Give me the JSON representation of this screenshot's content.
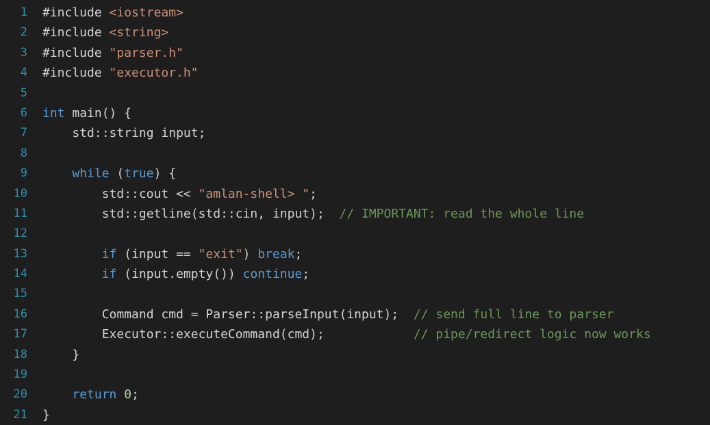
{
  "editor": {
    "colors": {
      "background": "#1e1e1e",
      "line_number": "#2b91af",
      "plain": "#d4d4d4",
      "string": "#ce9178",
      "keyword": "#569cd6",
      "number": "#b5cea8",
      "comment": "#6a9955"
    },
    "lines": [
      {
        "number": "1",
        "tokens": [
          {
            "t": "#include ",
            "k": "directive"
          },
          {
            "t": "<iostream>",
            "k": "string"
          }
        ]
      },
      {
        "number": "2",
        "tokens": [
          {
            "t": "#include ",
            "k": "directive"
          },
          {
            "t": "<string>",
            "k": "string"
          }
        ]
      },
      {
        "number": "3",
        "tokens": [
          {
            "t": "#include ",
            "k": "directive"
          },
          {
            "t": "\"parser.h\"",
            "k": "string"
          }
        ]
      },
      {
        "number": "4",
        "tokens": [
          {
            "t": "#include ",
            "k": "directive"
          },
          {
            "t": "\"executor.h\"",
            "k": "string"
          }
        ]
      },
      {
        "number": "5",
        "tokens": []
      },
      {
        "number": "6",
        "tokens": [
          {
            "t": "int",
            "k": "keyword"
          },
          {
            "t": " main() {",
            "k": "plain"
          }
        ]
      },
      {
        "number": "7",
        "tokens": [
          {
            "t": "    std::string input;",
            "k": "plain"
          }
        ]
      },
      {
        "number": "8",
        "tokens": []
      },
      {
        "number": "9",
        "tokens": [
          {
            "t": "    ",
            "k": "plain"
          },
          {
            "t": "while",
            "k": "control"
          },
          {
            "t": " (",
            "k": "plain"
          },
          {
            "t": "true",
            "k": "keyword"
          },
          {
            "t": ") {",
            "k": "plain"
          }
        ]
      },
      {
        "number": "10",
        "tokens": [
          {
            "t": "        std::cout << ",
            "k": "plain"
          },
          {
            "t": "\"amlan-shell> \"",
            "k": "string"
          },
          {
            "t": ";",
            "k": "plain"
          }
        ]
      },
      {
        "number": "11",
        "tokens": [
          {
            "t": "        std::getline(std::cin, input);  ",
            "k": "plain"
          },
          {
            "t": "// IMPORTANT: read the whole line",
            "k": "comment"
          }
        ]
      },
      {
        "number": "12",
        "tokens": []
      },
      {
        "number": "13",
        "tokens": [
          {
            "t": "        ",
            "k": "plain"
          },
          {
            "t": "if",
            "k": "control"
          },
          {
            "t": " (input == ",
            "k": "plain"
          },
          {
            "t": "\"exit\"",
            "k": "string"
          },
          {
            "t": ") ",
            "k": "plain"
          },
          {
            "t": "break",
            "k": "control"
          },
          {
            "t": ";",
            "k": "plain"
          }
        ]
      },
      {
        "number": "14",
        "tokens": [
          {
            "t": "        ",
            "k": "plain"
          },
          {
            "t": "if",
            "k": "control"
          },
          {
            "t": " (input.empty()) ",
            "k": "plain"
          },
          {
            "t": "continue",
            "k": "control"
          },
          {
            "t": ";",
            "k": "plain"
          }
        ]
      },
      {
        "number": "15",
        "tokens": []
      },
      {
        "number": "16",
        "tokens": [
          {
            "t": "        Command cmd = Parser::parseInput(input);  ",
            "k": "plain"
          },
          {
            "t": "// send full line to parser",
            "k": "comment"
          }
        ]
      },
      {
        "number": "17",
        "tokens": [
          {
            "t": "        Executor::executeCommand(cmd);            ",
            "k": "plain"
          },
          {
            "t": "// pipe/redirect logic now works",
            "k": "comment"
          }
        ]
      },
      {
        "number": "18",
        "tokens": [
          {
            "t": "    }",
            "k": "plain"
          }
        ]
      },
      {
        "number": "19",
        "tokens": []
      },
      {
        "number": "20",
        "tokens": [
          {
            "t": "    ",
            "k": "plain"
          },
          {
            "t": "return",
            "k": "control"
          },
          {
            "t": " ",
            "k": "plain"
          },
          {
            "t": "0",
            "k": "number"
          },
          {
            "t": ";",
            "k": "plain"
          }
        ]
      },
      {
        "number": "21",
        "tokens": [
          {
            "t": "}",
            "k": "plain"
          }
        ]
      }
    ]
  }
}
